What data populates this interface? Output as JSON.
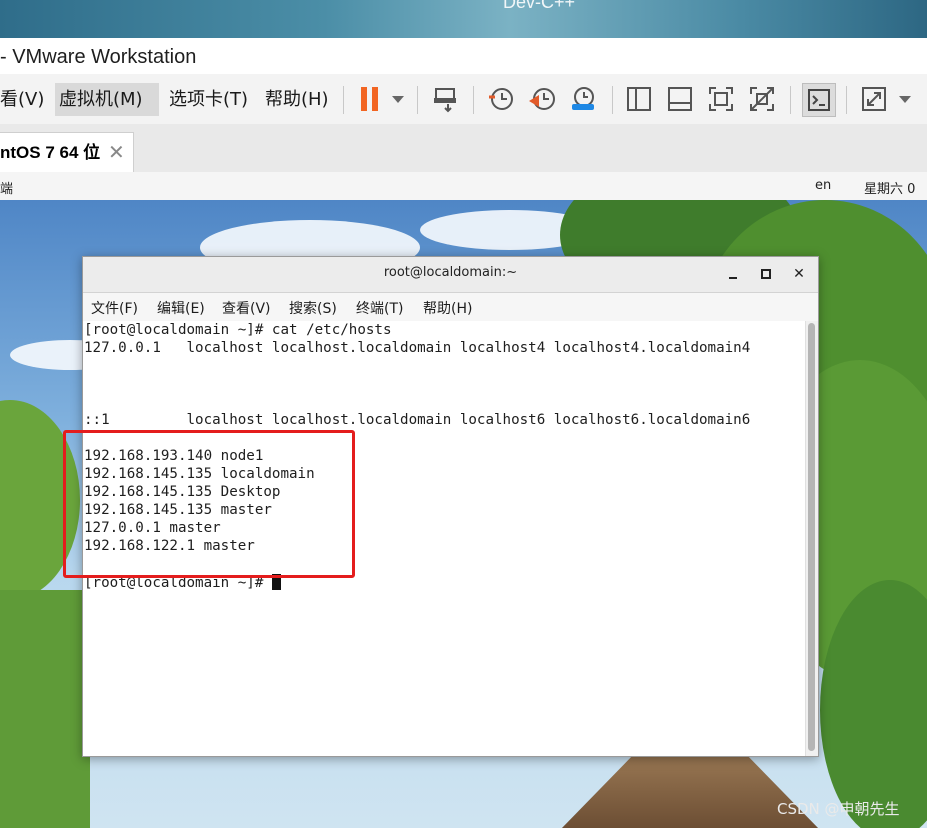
{
  "host_window_title": "Dev-C++",
  "vmware": {
    "title": "- VMware Workstation",
    "menu": [
      "看(V)",
      "虚拟机(M)",
      "选项卡(T)",
      "帮助(H)"
    ],
    "active_menu": "虚拟机(M)",
    "toolbar_icons": [
      "pause-icon",
      "dropdown-icon",
      "send-keys-icon",
      "snapshot-icon",
      "revert-snapshot-icon",
      "manage-snapshots-icon",
      "sidebar-view-icon",
      "thumbnail-view-icon",
      "fullscreen-icon",
      "unity-icon",
      "console-view-icon",
      "stretch-icon",
      "dropdown-icon"
    ],
    "tab_label": "ntOS 7 64 位"
  },
  "gnome_bar": {
    "left": "端",
    "lang": "en",
    "clock": "星期六 0"
  },
  "terminal": {
    "title": "root@localdomain:~",
    "menu": [
      "文件(F)",
      "编辑(E)",
      "查看(V)",
      "搜索(S)",
      "终端(T)",
      "帮助(H)"
    ],
    "lines": [
      "[root@localdomain ~]# cat /etc/hosts",
      "127.0.0.1   localhost localhost.localdomain localhost4 localhost4.localdomain4",
      "",
      "",
      "",
      "::1         localhost localhost.localdomain localhost6 localhost6.localdomain6",
      "",
      "192.168.193.140 node1",
      "192.168.145.135 localdomain",
      "192.168.145.135 Desktop",
      "192.168.145.135 master",
      "127.0.0.1 master",
      "192.168.122.1 master",
      "",
      "[root@localdomain ~]# "
    ]
  },
  "watermark": "CSDN @申朝先生",
  "colors": {
    "highlight": "#e41d1d",
    "pause": "#f26522",
    "accent_blue": "#1e88e5"
  }
}
